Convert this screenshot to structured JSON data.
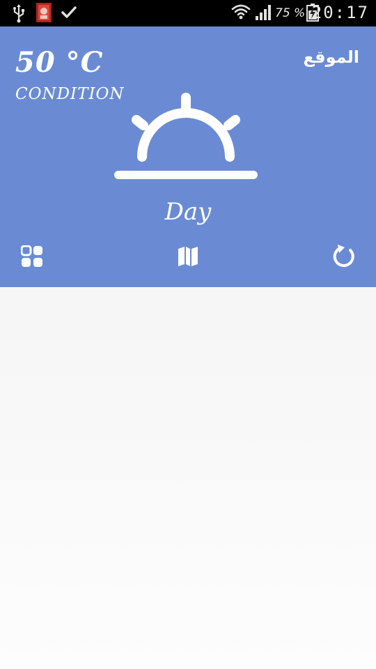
{
  "status_bar": {
    "battery_percent": "75 %",
    "time": "20:17",
    "icons": [
      "usb-icon",
      "app-notification-icon",
      "check-icon",
      "wifi-icon",
      "signal-icon",
      "battery-charging-icon"
    ]
  },
  "weather": {
    "temperature": "50 °C",
    "condition": "CONDITION",
    "location": "الموقع",
    "period": "Day",
    "icon": "sunrise-icon"
  },
  "actions": {
    "left_icon": "grid-icon",
    "center_icon": "map-icon",
    "right_icon": "refresh-icon"
  },
  "colors": {
    "header_bg": "#6a8bd4",
    "status_bar_bg": "#000000",
    "foreground": "#ffffff"
  }
}
